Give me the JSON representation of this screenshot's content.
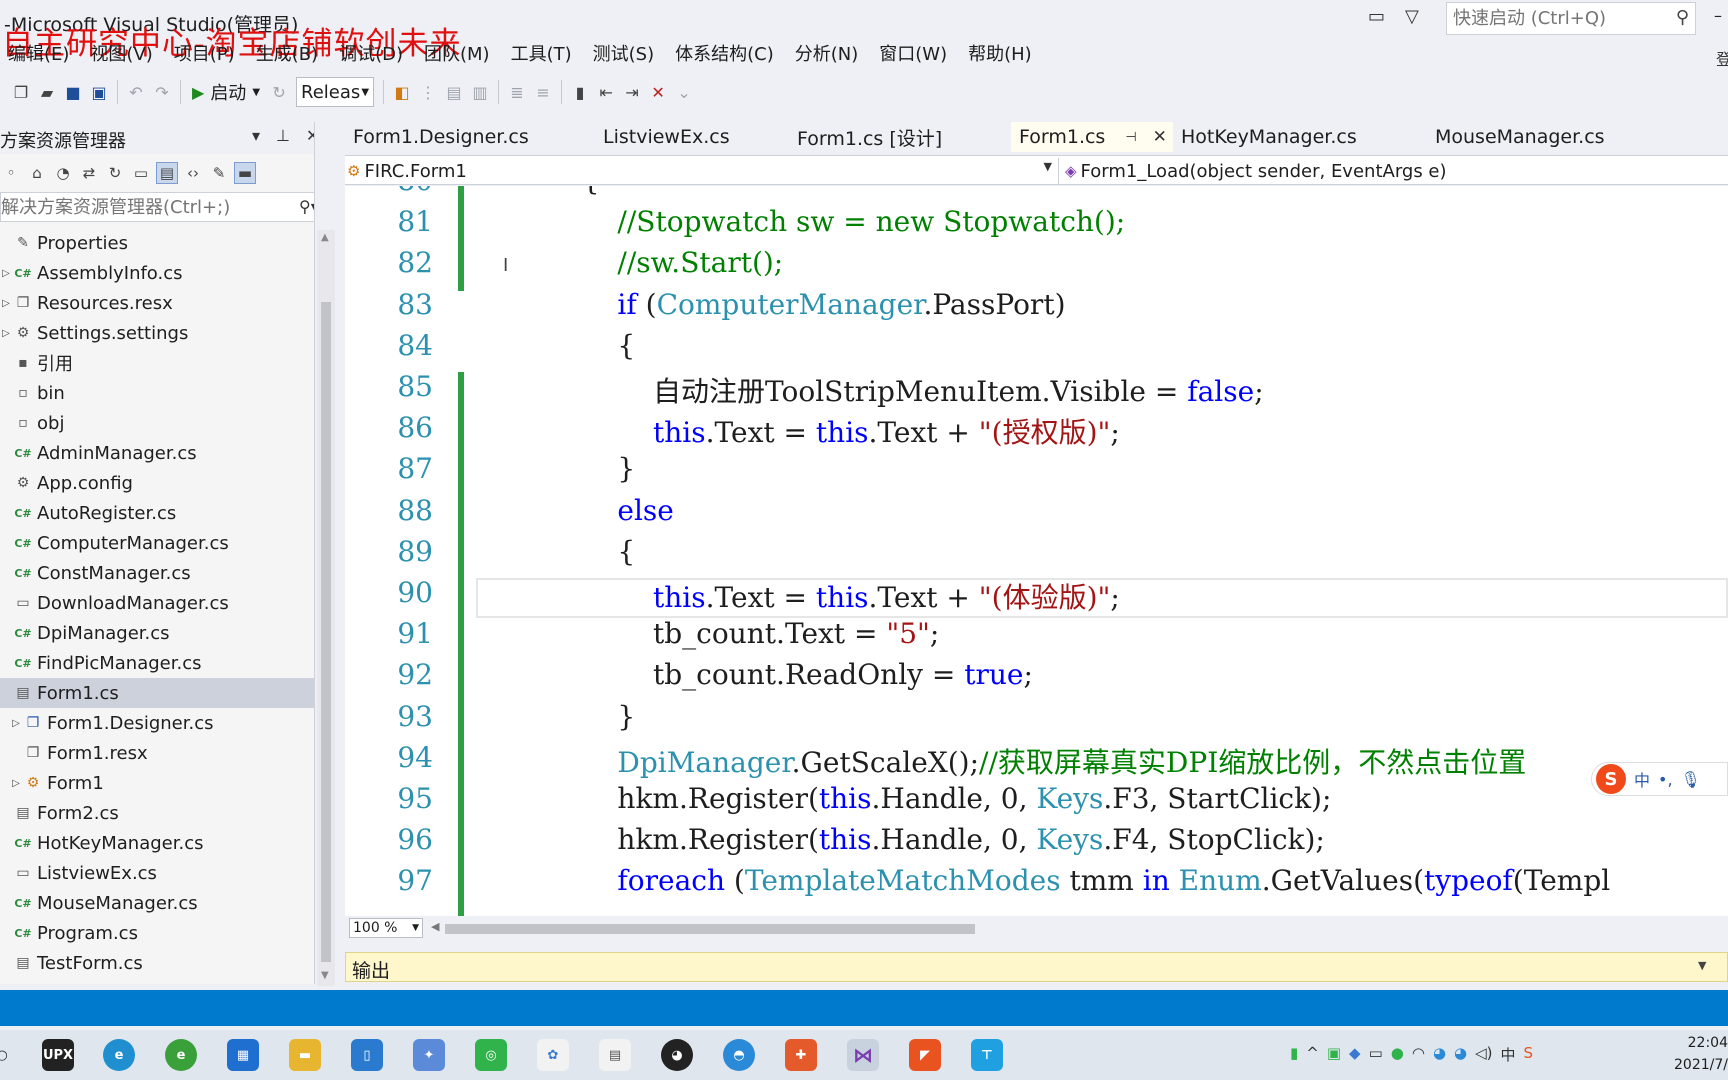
{
  "window": {
    "title": "-Microsoft Visual Studio(管理员)",
    "watermark": "自主研究中心-淘宝店铺软创未来",
    "quick_launch_placeholder": "快速启动 (Ctrl+Q)",
    "top_right_text": "登"
  },
  "menu": [
    "编辑(E)",
    "视图(V)",
    "项目(P)",
    "生成(B)",
    "调试(D)",
    "团队(M)",
    "工具(T)",
    "测试(S)",
    "体系结构(C)",
    "分析(N)",
    "窗口(W)",
    "帮助(H)"
  ],
  "toolbar": {
    "start_label": "启动",
    "config_value": "Releas"
  },
  "solution_explorer": {
    "title": "方案资源管理器",
    "search_placeholder": "解决方案资源管理器(Ctrl+;)",
    "items": [
      {
        "label": "Properties",
        "icon": "wrench-icon",
        "expander": false
      },
      {
        "label": "AssemblyInfo.cs",
        "icon": "csharp-file-icon",
        "expander": true
      },
      {
        "label": "Resources.resx",
        "icon": "resource-file-icon",
        "expander": true
      },
      {
        "label": "Settings.settings",
        "icon": "settings-gear-icon",
        "expander": true
      },
      {
        "label": "引用",
        "icon": "references-icon",
        "expander": false
      },
      {
        "label": "bin",
        "icon": "folder-icon",
        "expander": false
      },
      {
        "label": "obj",
        "icon": "folder-icon",
        "expander": false
      },
      {
        "label": "AdminManager.cs",
        "icon": "csharp-file-icon",
        "expander": false
      },
      {
        "label": "App.config",
        "icon": "config-file-icon",
        "expander": false
      },
      {
        "label": "AutoRegister.cs",
        "icon": "csharp-file-icon",
        "expander": false
      },
      {
        "label": "ComputerManager.cs",
        "icon": "csharp-file-icon",
        "expander": false
      },
      {
        "label": "ConstManager.cs",
        "icon": "csharp-file-icon",
        "expander": false
      },
      {
        "label": "DownloadManager.cs",
        "icon": "file-icon",
        "expander": false
      },
      {
        "label": "DpiManager.cs",
        "icon": "csharp-file-icon",
        "expander": false
      },
      {
        "label": "FindPicManager.cs",
        "icon": "csharp-file-icon",
        "expander": false
      },
      {
        "label": "Form1.cs",
        "icon": "form-icon",
        "expander": false,
        "selected": true
      },
      {
        "label": "Form1.Designer.cs",
        "icon": "designer-file-icon",
        "expander": true,
        "indent": true
      },
      {
        "label": "Form1.resx",
        "icon": "resource-file-icon",
        "expander": false,
        "indent": true
      },
      {
        "label": "Form1",
        "icon": "class-icon",
        "expander": true,
        "indent": true
      },
      {
        "label": "Form2.cs",
        "icon": "form-icon",
        "expander": false
      },
      {
        "label": "HotKeyManager.cs",
        "icon": "csharp-file-icon",
        "expander": false
      },
      {
        "label": "ListviewEx.cs",
        "icon": "file-icon",
        "expander": false
      },
      {
        "label": "MouseManager.cs",
        "icon": "csharp-file-icon",
        "expander": false
      },
      {
        "label": "Program.cs",
        "icon": "csharp-file-icon",
        "expander": false
      },
      {
        "label": "TestForm.cs",
        "icon": "form-icon",
        "expander": false
      }
    ]
  },
  "tabs": [
    {
      "label": "Form1.Designer.cs",
      "active": false
    },
    {
      "label": "ListviewEx.cs",
      "active": false
    },
    {
      "label": "Form1.cs [设计]",
      "active": false
    },
    {
      "label": "Form1.cs",
      "active": true
    },
    {
      "label": "HotKeyManager.cs",
      "active": false
    },
    {
      "label": "MouseManager.cs",
      "active": false
    }
  ],
  "navbar": {
    "class_selector": "FIRC.Form1",
    "member_selector": "Form1_Load(object sender, EventArgs e)"
  },
  "editor": {
    "zoom": "100 %",
    "lines": [
      {
        "n": "80",
        "text": "            {"
      },
      {
        "n": "81",
        "text": "                //Stopwatch sw = new Stopwatch();"
      },
      {
        "n": "82",
        "text": "                //sw.Start();"
      },
      {
        "n": "83",
        "text": "                if (ComputerManager.PassPort)"
      },
      {
        "n": "84",
        "text": "                {"
      },
      {
        "n": "85",
        "text": "                    自动注册ToolStripMenuItem.Visible = false;"
      },
      {
        "n": "86",
        "text": "                    this.Text = this.Text + \"(授权版)\";"
      },
      {
        "n": "87",
        "text": "                }"
      },
      {
        "n": "88",
        "text": "                else"
      },
      {
        "n": "89",
        "text": "                {"
      },
      {
        "n": "90",
        "text": "                    this.Text = this.Text + \"(体验版)\";"
      },
      {
        "n": "91",
        "text": "                    tb_count.Text = \"5\";"
      },
      {
        "n": "92",
        "text": "                    tb_count.ReadOnly = true;"
      },
      {
        "n": "93",
        "text": "                }"
      },
      {
        "n": "94",
        "text": "                DpiManager.GetScaleX();//获取屏幕真实DPI缩放比例，不然点击位置"
      },
      {
        "n": "95",
        "text": "                hkm.Register(this.Handle, 0, Keys.F3, StartClick);"
      },
      {
        "n": "96",
        "text": "                hkm.Register(this.Handle, 0, Keys.F4, StopClick);"
      },
      {
        "n": "97",
        "text": "                foreach (TemplateMatchModes tmm in Enum.GetValues(typeof(Templ"
      }
    ]
  },
  "output": {
    "title": "输出"
  },
  "ime": {
    "lang": "中"
  },
  "taskbar": {
    "apps": [
      "start-icon",
      "upx-icon",
      "edge-icon",
      "ie-icon",
      "store-icon",
      "explorer-icon",
      "notepad-icon",
      "app-icon",
      "wechat-icon",
      "app2-icon",
      "notes-icon",
      "qq-icon",
      "app3-icon",
      "app4-icon",
      "visual-studio-icon",
      "app5-icon",
      "app6-icon"
    ],
    "upx_label": "UPX",
    "tray_lang": "中",
    "clock_time": "22:04",
    "clock_date": "2021/7/"
  }
}
